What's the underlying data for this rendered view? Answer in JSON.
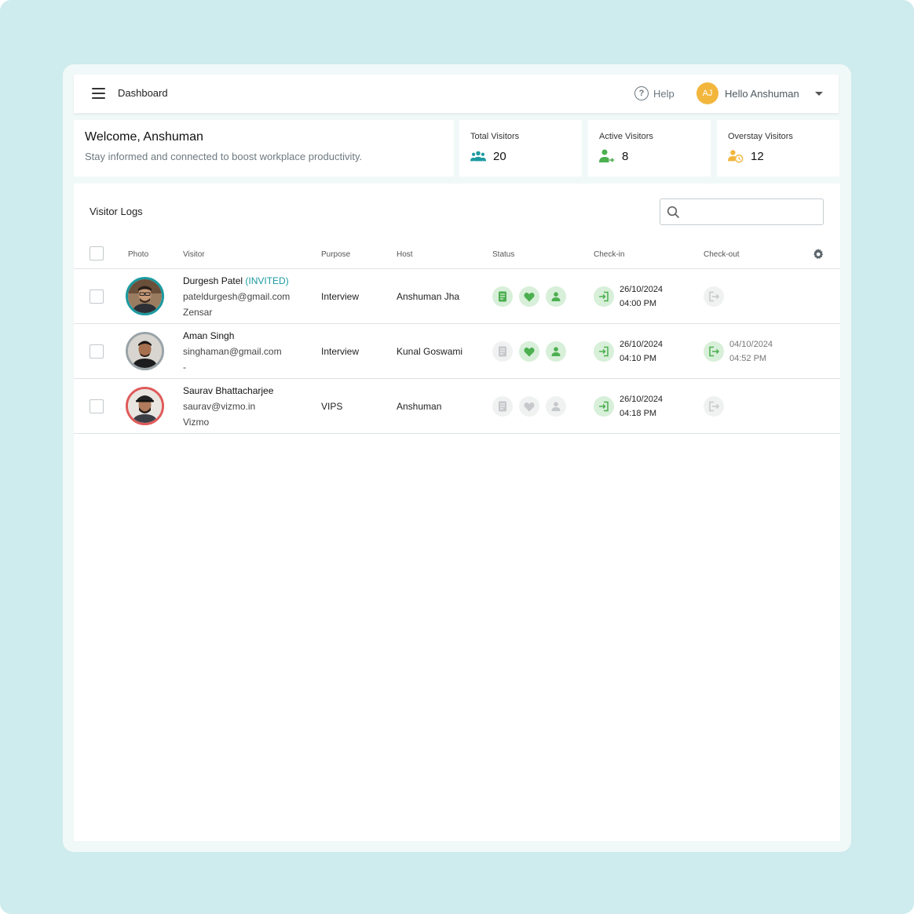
{
  "header": {
    "menu_icon": "hamburger-menu-icon",
    "title": "Dashboard",
    "help_label": "Help",
    "user_initials": "AJ",
    "user_greeting": "Hello Anshuman",
    "accent_color": "#f2b63d"
  },
  "welcome": {
    "title": "Welcome, Anshuman",
    "subtitle": "Stay informed and connected to boost workplace productivity."
  },
  "stats": [
    {
      "label": "Total Visitors",
      "value": "20",
      "icon": "group-icon",
      "color": "#1b9aa0"
    },
    {
      "label": "Active Visitors",
      "value": "8",
      "icon": "person-arrow-icon",
      "color": "#4caf50"
    },
    {
      "label": "Overstay Visitors",
      "value": "12",
      "icon": "person-clock-icon",
      "color": "#f2b63d"
    }
  ],
  "logs": {
    "title": "Visitor Logs",
    "search_placeholder": "",
    "columns": [
      "Photo",
      "Visitor",
      "Purpose",
      "Host",
      "Status",
      "Check-in",
      "Check-out"
    ],
    "rows": [
      {
        "name": "Durgesh Patel",
        "tag": "(INVITED)",
        "email": "pateldurgesh@gmail.com",
        "company": "Zensar",
        "purpose": "Interview",
        "host": "Anshuman Jha",
        "photo_border": "#1b9aa0",
        "status": {
          "document": true,
          "health": true,
          "person": true
        },
        "checkin_date": "26/10/2024",
        "checkin_time": "04:00 PM",
        "checkout_date": "",
        "checkout_time": "",
        "checked_out": false
      },
      {
        "name": "Aman Singh",
        "tag": "",
        "email": "singhaman@gmail.com",
        "company": "-",
        "purpose": "Interview",
        "host": "Kunal Goswami",
        "photo_border": "#9aa3a8",
        "status": {
          "document": false,
          "health": true,
          "person": true
        },
        "checkin_date": "26/10/2024",
        "checkin_time": "04:10 PM",
        "checkout_date": "04/10/2024",
        "checkout_time": "04:52 PM",
        "checked_out": true
      },
      {
        "name": "Saurav Bhattacharjee",
        "tag": "",
        "email": "saurav@vizmo.in",
        "company": "Vizmo",
        "purpose": "VIPS",
        "host": "Anshuman",
        "photo_border": "#e05a5a",
        "status": {
          "document": false,
          "health": false,
          "person": false
        },
        "checkin_date": "26/10/2024",
        "checkin_time": "04:18 PM",
        "checkout_date": "",
        "checkout_time": "",
        "checked_out": false
      }
    ]
  },
  "colors": {
    "status_on": "#4caf50",
    "status_off": "#c5c9cb",
    "background": "#ceebed"
  }
}
